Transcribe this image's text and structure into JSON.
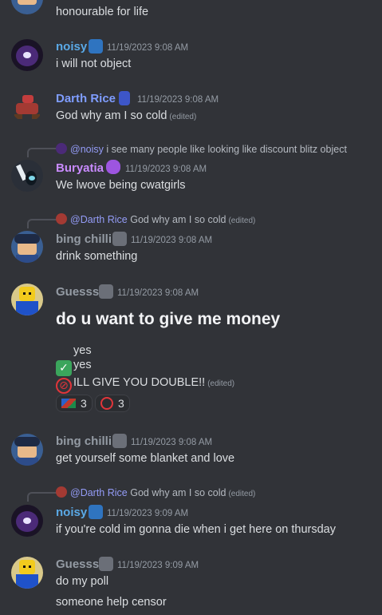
{
  "colors": {
    "background": "#313338",
    "noisy_name": "#5aa9e6",
    "darth_name": "#7f9dff",
    "buryatia_name": "#c98bff",
    "grey_name": "#949ba4",
    "mention": "#949cf7"
  },
  "messages": [
    {
      "text": "honourable for life"
    },
    {
      "author": "noisy",
      "timestamp": "11/19/2023 9:08 AM",
      "text": "i will not object",
      "badge_icon": "astronaut-badge-icon"
    },
    {
      "author": "Darth Rice",
      "timestamp": "11/19/2023 9:08 AM",
      "text": "God why am I so cold",
      "edited": "(edited)",
      "badge_icon": "phone-badge-icon"
    },
    {
      "reply_mention": "@noisy",
      "reply_text": "i see many people like looking like discount blitz object",
      "author": "Buryatia",
      "timestamp": "11/19/2023 9:08 AM",
      "text": "We lwove being cwatgirls",
      "badge_icon": "purple-blob-badge-icon"
    },
    {
      "reply_mention": "@Darth Rice",
      "reply_text": "God why am I so cold",
      "reply_edited": "(edited)",
      "author": "bing chilli",
      "timestamp": "11/19/2023 9:08 AM",
      "text": "drink something",
      "badge_icon": "skull-badge-icon"
    },
    {
      "author": "Guesss",
      "timestamp": "11/19/2023 9:08 AM",
      "poll_title": "do u want to give me money",
      "options": [
        "yes",
        "yes",
        "ILL GIVE YOU DOUBLE!!"
      ],
      "option3_edited": "(edited)",
      "reactions": [
        {
          "icon": "namibia-flag-icon",
          "count": "3"
        },
        {
          "icon": "no-entry-icon",
          "count": "3"
        }
      ],
      "badge_icon": "skull-badge-icon"
    },
    {
      "author": "bing chilli",
      "timestamp": "11/19/2023 9:08 AM",
      "text": "get yourself some blanket and love",
      "badge_icon": "skull-badge-icon"
    },
    {
      "reply_mention": "@Darth Rice",
      "reply_text": "God why am I so cold",
      "reply_edited": "(edited)",
      "author": "noisy",
      "timestamp": "11/19/2023 9:09 AM",
      "text": "if you're cold im gonna die when i get here on thursday",
      "badge_icon": "astronaut-badge-icon"
    },
    {
      "author": "Guesss",
      "timestamp": "11/19/2023 9:09 AM",
      "text": "do my poll",
      "text2": "someone help censor",
      "badge_icon": "skull-badge-icon"
    }
  ]
}
